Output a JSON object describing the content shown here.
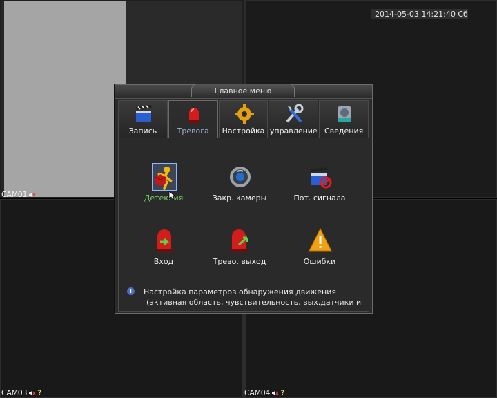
{
  "datetime": "2014-05-03 14:21:40 Сб",
  "cameras": [
    {
      "name": "CAM01",
      "badge": ""
    },
    {
      "name": "CAM03",
      "badge": "?"
    },
    {
      "name": "CAM04",
      "badge": "?"
    }
  ],
  "menu": {
    "title": "Главное меню",
    "tabs": [
      {
        "label": "Запись",
        "icon": "clapperboard-icon"
      },
      {
        "label": "Тревога",
        "icon": "alarm-siren-icon",
        "active": true
      },
      {
        "label": "Настройка",
        "icon": "gear-icon"
      },
      {
        "label": "управление",
        "icon": "tools-icon"
      },
      {
        "label": "Сведения",
        "icon": "hdd-info-icon"
      }
    ],
    "items": [
      {
        "label": "Детекция",
        "icon": "motion-detect-icon",
        "selected": true
      },
      {
        "label": "Закр. камеры",
        "icon": "camera-blind-icon"
      },
      {
        "label": "Пот. сигнала",
        "icon": "video-loss-icon"
      },
      {
        "label": "Вход",
        "icon": "alarm-input-icon"
      },
      {
        "label": "Трево. выход",
        "icon": "alarm-output-icon"
      },
      {
        "label": "Ошибки",
        "icon": "warning-icon"
      }
    ],
    "hint_line1": "Настройка параметров обнаружения движения",
    "hint_line2": "(активная область, чувствительность, вых.датчики и"
  },
  "colors": {
    "active_tab_label": "#9ab0c8",
    "selected_item_label": "#7fd36a"
  }
}
